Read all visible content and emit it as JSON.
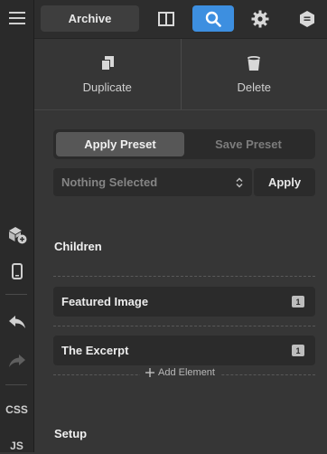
{
  "toolbar": {
    "archive_label": "Archive",
    "icons": [
      "columns-icon",
      "search-icon",
      "gear-icon",
      "hex-badge-icon"
    ],
    "active_color": "#3d8fe0"
  },
  "left_rail": {
    "css_label": "CSS",
    "js_label": "JS"
  },
  "actions": {
    "duplicate_label": "Duplicate",
    "delete_label": "Delete"
  },
  "preset": {
    "tabs": [
      "Apply Preset",
      "Save Preset"
    ],
    "active_tab": "Apply Preset",
    "select_value": "Nothing Selected",
    "apply_label": "Apply"
  },
  "children": {
    "heading": "Children",
    "items": [
      {
        "label": "Featured Image",
        "count": "1"
      },
      {
        "label": "The Excerpt",
        "count": "1"
      }
    ],
    "add_label": "Add Element"
  },
  "setup": {
    "heading": "Setup"
  }
}
